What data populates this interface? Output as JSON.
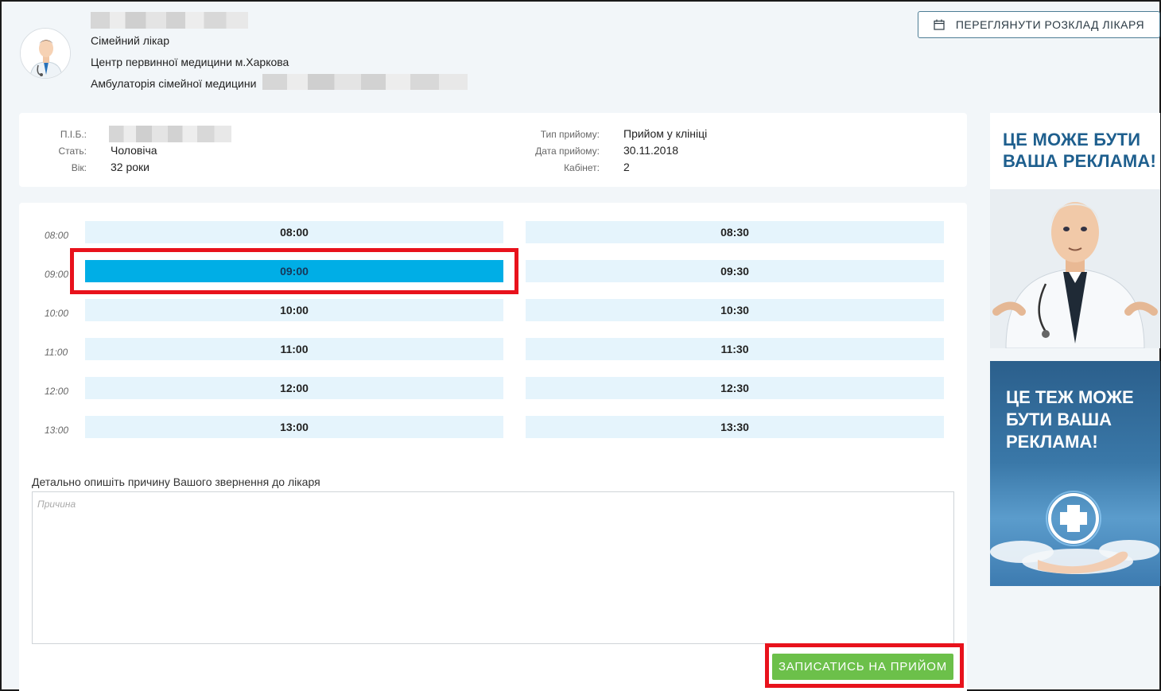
{
  "doctor": {
    "role": "Сімейний лікар",
    "center": "Центр первинної медицини м.Харкова",
    "ambulatory": "Амбулаторія сімейної медицини"
  },
  "header": {
    "schedule_button": "ПЕРЕГЛЯНУТИ РОЗКЛАД ЛІКАРЯ"
  },
  "patient": {
    "name_label": "П.І.Б.:",
    "gender_label": "Стать:",
    "gender": "Чоловіча",
    "age_label": "Вік:",
    "age": "32 роки",
    "appointment_type_label": "Тип прийому:",
    "appointment_type": "Прийом у клініці",
    "date_label": "Дата прийому:",
    "date": "30.11.2018",
    "cabinet_label": "Кабінет:",
    "cabinet": "2"
  },
  "slots": {
    "hours": [
      "08:00",
      "09:00",
      "10:00",
      "11:00",
      "12:00",
      "13:00"
    ],
    "left": [
      "08:00",
      "09:00",
      "10:00",
      "11:00",
      "12:00",
      "13:00"
    ],
    "right": [
      "08:30",
      "09:30",
      "10:30",
      "11:30",
      "12:30",
      "13:30"
    ],
    "selected": "09:00"
  },
  "reason": {
    "label": "Детально опишіть причину Вашого звернення до лікаря",
    "placeholder": "Причина",
    "value": ""
  },
  "submit_button": "ЗАПИСАТИСЬ НА ПРИЙОМ",
  "ads": {
    "ad1_text": "ЦЕ МОЖЕ БУТИ ВАША РЕКЛАМА!",
    "ad2_text": "ЦЕ ТЕЖ МОЖЕ БУТИ ВАША РЕКЛАМА!"
  },
  "colors": {
    "slot_bg": "#e5f4fc",
    "slot_selected": "#00aee6",
    "submit": "#6cc04a",
    "highlight": "#e8121c"
  }
}
